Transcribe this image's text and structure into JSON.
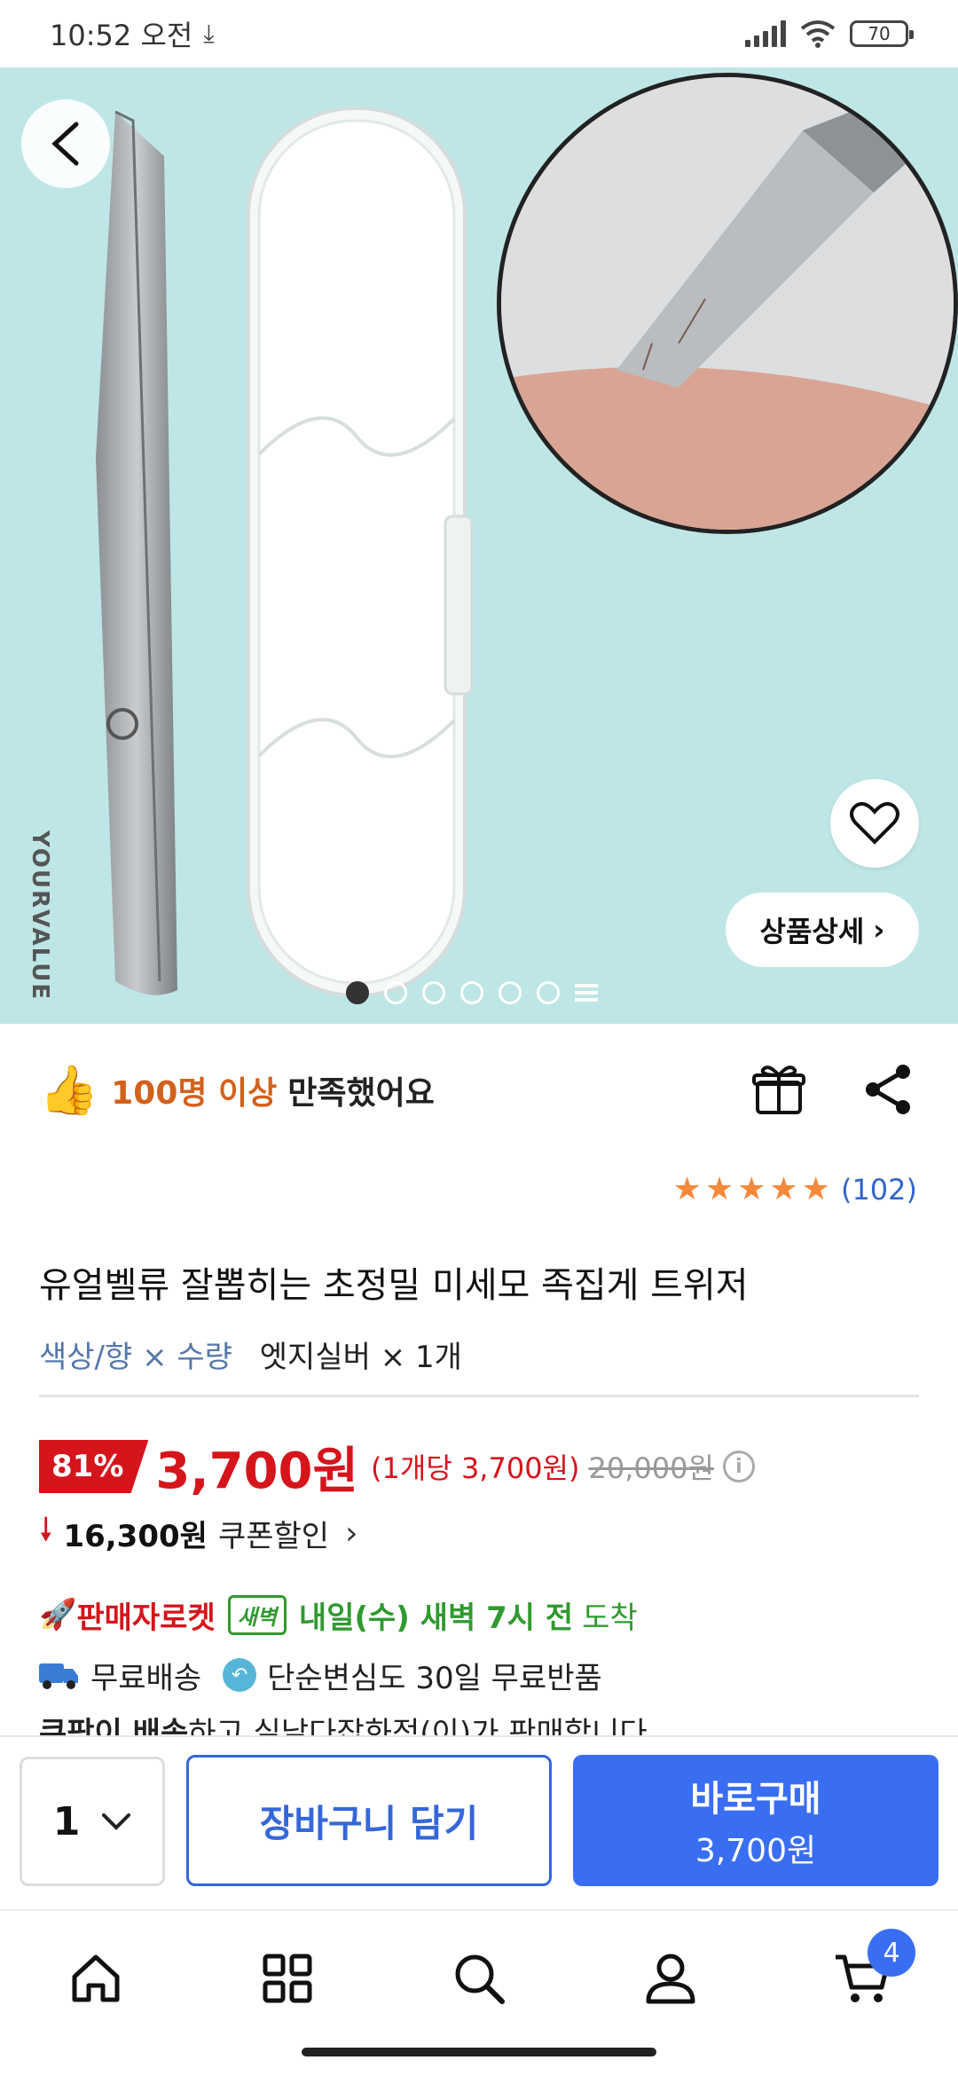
{
  "status_bar": {
    "time": "10:52 오전",
    "battery": "70"
  },
  "product_image": {
    "brand_text": "YOURVALUE",
    "detail_button": "상품상세",
    "slide_count": 6,
    "active_slide": 1
  },
  "satisfaction": {
    "highlight": "100명 이상",
    "rest": "만족했어요"
  },
  "rating": {
    "stars": 5,
    "count": "(102)"
  },
  "product": {
    "title": "유얼벨류 잘뽑히는 초정밀 미세모 족집게 트위저",
    "option_label": "색상/향 × 수량",
    "option_value": "엣지실버 × 1개"
  },
  "price": {
    "discount": "81%",
    "sale_price": "3,700원",
    "unit_price": "(1개당 3,700원)",
    "original_price": "20,000원",
    "coupon_amount": "16,300원",
    "coupon_label": "쿠폰할인"
  },
  "delivery": {
    "rocket_label": "판매자로켓",
    "dawn_tag": "새벽",
    "arrival": "내일(수) 새벽 7시 전",
    "arrival_suffix": "도착",
    "free_shipping": "무료배송",
    "free_return": "단순변심도 30일 무료반품",
    "seller_bold": "쿠팡이 배송",
    "seller_rest": "하고 실낱다잡화점(이)가 판매합니다"
  },
  "action_bar": {
    "quantity": "1",
    "cart_button": "장바구니 담기",
    "buy_button": "바로구매",
    "buy_price": "3,700원"
  },
  "bottom_nav": {
    "cart_badge": "4",
    "items": [
      "home-icon",
      "category-icon",
      "search-icon",
      "my-icon",
      "cart-icon"
    ]
  },
  "colors": {
    "accent_red": "#d5141b",
    "accent_blue": "#3a6ef2",
    "rocket_green": "#2f9a2f",
    "hero_bg": "#bfe6e6"
  }
}
